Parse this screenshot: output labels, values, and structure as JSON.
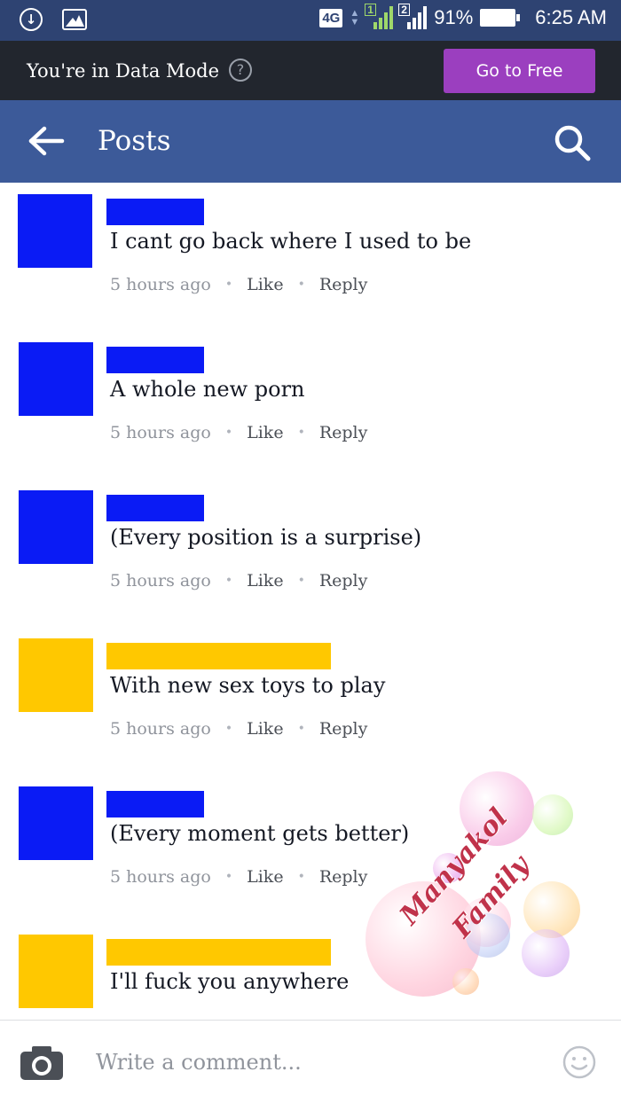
{
  "status_bar": {
    "network": "4G",
    "sim1": "1",
    "sim2": "2",
    "battery": "91%",
    "time": "6:25 AM"
  },
  "data_mode": {
    "text": "You're in Data Mode",
    "help": "?",
    "button": "Go to Free",
    "button_color": "#9b3fbf"
  },
  "header": {
    "title": "Posts",
    "color": "#3c5a99"
  },
  "comments": [
    {
      "text": "I cant go back where I used to be",
      "time": "5 hours ago",
      "like": "Like",
      "reply": "Reply",
      "redaction_color": "#0a1bf5"
    },
    {
      "text": "A whole new porn",
      "time": "5 hours ago",
      "like": "Like",
      "reply": "Reply",
      "redaction_color": "#0a1bf5"
    },
    {
      "text": "(Every position is a surprise)",
      "time": "5 hours ago",
      "like": "Like",
      "reply": "Reply",
      "redaction_color": "#0a1bf5"
    },
    {
      "text": "With new sex toys to play",
      "time": "5 hours ago",
      "like": "Like",
      "reply": "Reply",
      "redaction_color": "#ffc800"
    },
    {
      "text": "(Every moment gets better)",
      "time": "5 hours ago",
      "like": "Like",
      "reply": "Reply",
      "redaction_color": "#0a1bf5"
    },
    {
      "text": "I'll fuck you anywhere",
      "time": "",
      "like": "",
      "reply": "",
      "redaction_color": "#ffc800"
    }
  ],
  "watermark": {
    "line1": "Manyakol",
    "line2": "Family"
  },
  "footer": {
    "placeholder": "Write a comment..."
  },
  "icons": {
    "status_left": [
      "download-icon",
      "image-icon"
    ],
    "header": [
      "back-arrow-icon",
      "search-icon"
    ],
    "footer": [
      "camera-icon",
      "emoji-icon"
    ]
  }
}
